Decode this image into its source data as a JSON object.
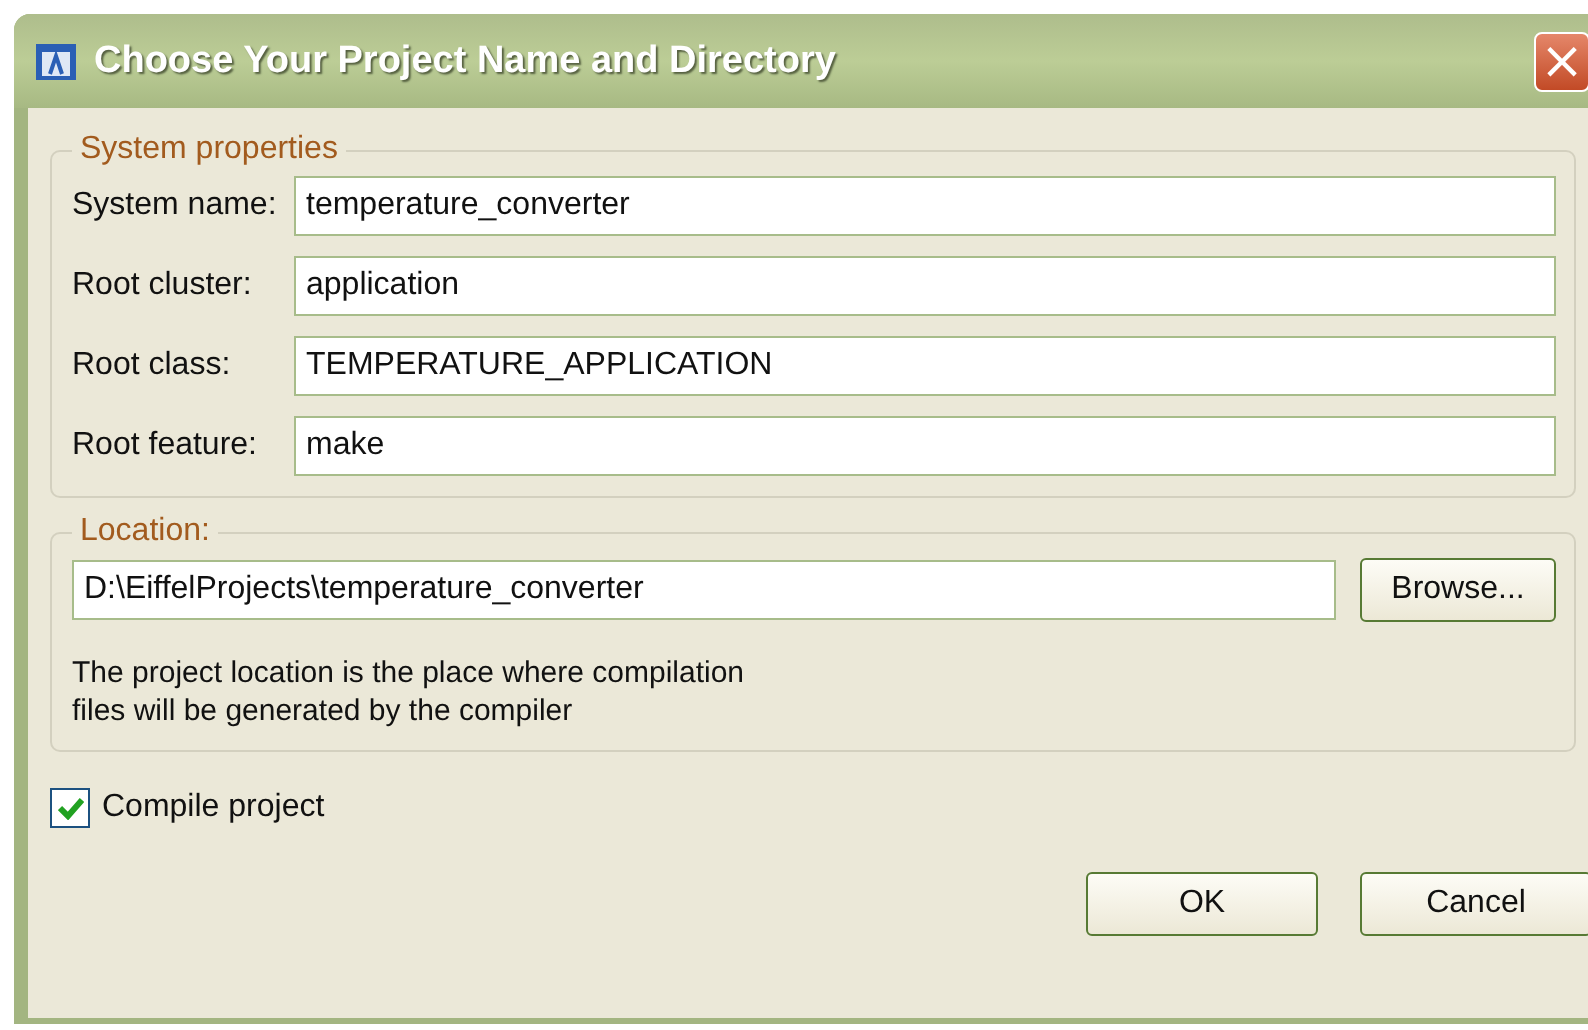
{
  "window": {
    "title": "Choose Your Project Name and Directory",
    "close": "×"
  },
  "system_properties": {
    "legend": "System properties",
    "fields": [
      {
        "label": "System name:",
        "value": "temperature_converter"
      },
      {
        "label": "Root cluster:",
        "value": "application"
      },
      {
        "label": "Root class:",
        "value": "TEMPERATURE_APPLICATION"
      },
      {
        "label": "Root feature:",
        "value": "make"
      }
    ]
  },
  "location": {
    "legend": "Location:",
    "value": "D:\\EiffelProjects\\temperature_converter",
    "browse": "Browse...",
    "hint": [
      "The project location is the place where compilation",
      "files will be generated by the compiler"
    ]
  },
  "compile": {
    "label": "Compile project",
    "checked": true
  },
  "buttons": [
    "OK",
    "Cancel"
  ]
}
